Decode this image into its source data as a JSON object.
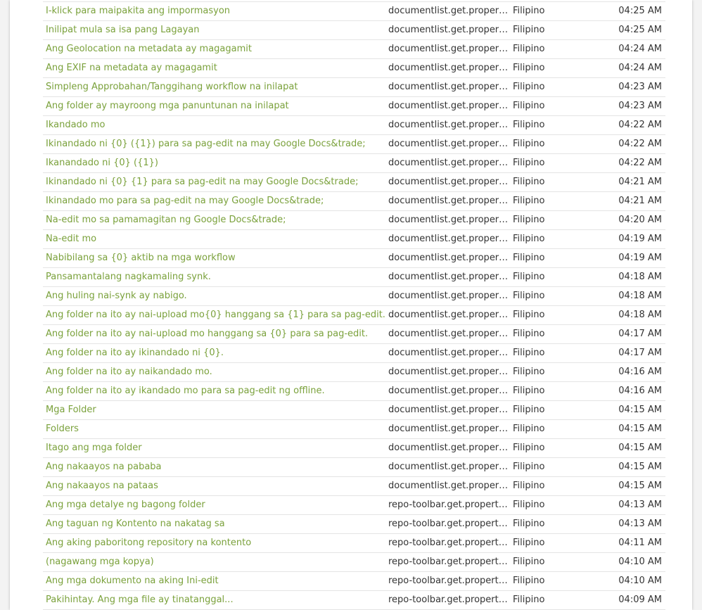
{
  "colors": {
    "link": "#7aa13b",
    "text": "#333333",
    "row_border": "#e4e4e4"
  },
  "rows": [
    {
      "text": "I-klick para maipakita ang impormasyon",
      "file": "documentlist.get.properties",
      "lang": "Filipino",
      "time": "04:25 AM"
    },
    {
      "text": "Inilipat mula sa isa pang Lagayan",
      "file": "documentlist.get.properties",
      "lang": "Filipino",
      "time": "04:25 AM"
    },
    {
      "text": "Ang Geolocation na metadata ay magagamit",
      "file": "documentlist.get.properties",
      "lang": "Filipino",
      "time": "04:24 AM"
    },
    {
      "text": "Ang EXIF na metadata ay magagamit",
      "file": "documentlist.get.properties",
      "lang": "Filipino",
      "time": "04:24 AM"
    },
    {
      "text": "Simpleng Approbahan/Tanggihang workflow na inilapat",
      "file": "documentlist.get.properties",
      "lang": "Filipino",
      "time": "04:23 AM"
    },
    {
      "text": "Ang folder ay mayroong mga panuntunan na inilapat",
      "file": "documentlist.get.properties",
      "lang": "Filipino",
      "time": "04:23 AM"
    },
    {
      "text": "Ikandado mo",
      "file": "documentlist.get.properties",
      "lang": "Filipino",
      "time": "04:22 AM"
    },
    {
      "text": "Ikinandado ni {0} ({1}) para sa pag-edit na may Google Docs&trade;",
      "file": "documentlist.get.properties",
      "lang": "Filipino",
      "time": "04:22 AM"
    },
    {
      "text": "Ikanandado ni {0} ({1})",
      "file": "documentlist.get.properties",
      "lang": "Filipino",
      "time": "04:22 AM"
    },
    {
      "text": "Ikinandado ni {0} {1} para sa pag-edit na may Google Docs&trade;",
      "file": "documentlist.get.properties",
      "lang": "Filipino",
      "time": "04:21 AM"
    },
    {
      "text": "Ikinandado mo para sa pag-edit na may Google Docs&trade;",
      "file": "documentlist.get.properties",
      "lang": "Filipino",
      "time": "04:21 AM"
    },
    {
      "text": "Na-edit mo sa pamamagitan ng Google Docs&trade;",
      "file": "documentlist.get.properties",
      "lang": "Filipino",
      "time": "04:20 AM"
    },
    {
      "text": "Na-edit mo",
      "file": "documentlist.get.properties",
      "lang": "Filipino",
      "time": "04:19 AM"
    },
    {
      "text": "Nabibilang sa {0} aktib na mga workflow",
      "file": "documentlist.get.properties",
      "lang": "Filipino",
      "time": "04:19 AM"
    },
    {
      "text": "Pansamantalang nagkamaling synk.",
      "file": "documentlist.get.properties",
      "lang": "Filipino",
      "time": "04:18 AM"
    },
    {
      "text": "Ang huling nai-synk ay nabigo.",
      "file": "documentlist.get.properties",
      "lang": "Filipino",
      "time": "04:18 AM"
    },
    {
      "text": "Ang folder na ito ay nai-upload mo{0} hanggang sa {1} para sa pag-edit.",
      "file": "documentlist.get.properties",
      "lang": "Filipino",
      "time": "04:18 AM"
    },
    {
      "text": "Ang folder na ito ay nai-upload mo hanggang sa {0} para sa pag-edit.",
      "file": "documentlist.get.properties",
      "lang": "Filipino",
      "time": "04:17 AM"
    },
    {
      "text": "Ang folder na ito ay ikinandado ni {0}.",
      "file": "documentlist.get.properties",
      "lang": "Filipino",
      "time": "04:17 AM"
    },
    {
      "text": "Ang folder na ito ay naikandado mo.",
      "file": "documentlist.get.properties",
      "lang": "Filipino",
      "time": "04:16 AM"
    },
    {
      "text": "Ang folder na ito ay ikandado mo para sa pag-edit ng offline.",
      "file": "documentlist.get.properties",
      "lang": "Filipino",
      "time": "04:16 AM"
    },
    {
      "text": "Mga Folder",
      "file": "documentlist.get.properties",
      "lang": "Filipino",
      "time": "04:15 AM"
    },
    {
      "text": "Folders",
      "file": "documentlist.get.properties",
      "lang": "Filipino",
      "time": "04:15 AM"
    },
    {
      "text": "Itago ang mga folder",
      "file": "documentlist.get.properties",
      "lang": "Filipino",
      "time": "04:15 AM"
    },
    {
      "text": "Ang nakaayos na pababa",
      "file": "documentlist.get.properties",
      "lang": "Filipino",
      "time": "04:15 AM"
    },
    {
      "text": "Ang nakaayos na pataas",
      "file": "documentlist.get.properties",
      "lang": "Filipino",
      "time": "04:15 AM"
    },
    {
      "text": "Ang mga detalye ng bagong folder",
      "file": "repo-toolbar.get.properties",
      "lang": "Filipino",
      "time": "04:13 AM"
    },
    {
      "text": "Ang taguan ng Kontento na nakatag sa",
      "file": "repo-toolbar.get.properties",
      "lang": "Filipino",
      "time": "04:13 AM"
    },
    {
      "text": "Ang aking paboritong repository na kontento",
      "file": "repo-toolbar.get.properties",
      "lang": "Filipino",
      "time": "04:11 AM"
    },
    {
      "text": "(nagawang mga kopya)",
      "file": "repo-toolbar.get.properties",
      "lang": "Filipino",
      "time": "04:10 AM"
    },
    {
      "text": "Ang mga dokumento na aking Ini-edit",
      "file": "repo-toolbar.get.properties",
      "lang": "Filipino",
      "time": "04:10 AM"
    },
    {
      "text": "Pakihintay. Ang mga file ay tinatanggal...",
      "file": "repo-toolbar.get.properties",
      "lang": "Filipino",
      "time": "04:09 AM"
    }
  ]
}
